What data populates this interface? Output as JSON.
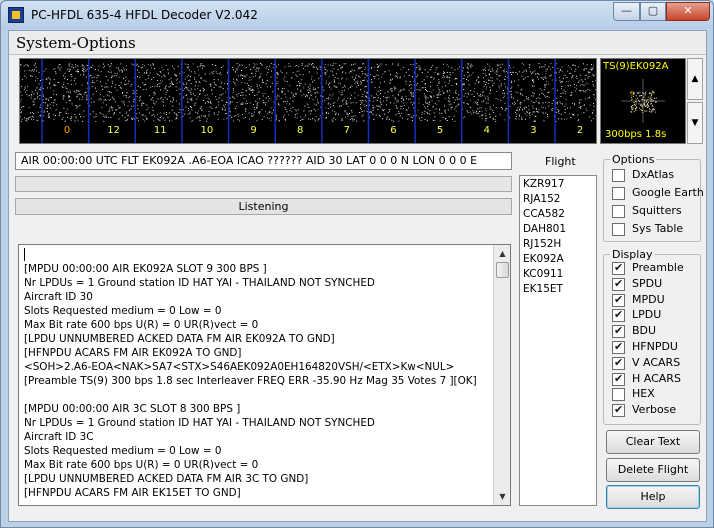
{
  "window": {
    "title": "PC-HFDL 635-4 HFDL Decoder V2.042",
    "controls": {
      "minimize": "—",
      "maximize": "▢",
      "close": "✕"
    }
  },
  "panel": {
    "title": "System-Options"
  },
  "spectrum": {
    "channel_labels": [
      "0",
      "12",
      "11",
      "10",
      "9",
      "8",
      "7",
      "6",
      "5",
      "4",
      "3",
      "2"
    ],
    "marker_color": "#1030c0",
    "label_color": "#ffa500"
  },
  "thumbnail": {
    "top_text": "TS(9)EK092A",
    "bottom_text": "300bps 1.8s"
  },
  "scroll_buttons": {
    "up": "▲",
    "down": "▼"
  },
  "message_line": "AIR 00:00:00  UTC FLT EK092A .A6-EOA ICAO ?????? AID 30 LAT 0 0 0  N  LON 0 0 0  E",
  "status": "Listening",
  "log_lines": [
    "[MPDU 00:00:00 AIR EK092A SLOT 9 300 BPS ]",
    "Nr LPDUs = 1 Ground station ID HAT YAI - THAILAND NOT SYNCHED",
    "Aircraft ID 30",
    "Slots Requested medium = 0 Low = 0",
    "Max Bit rate 600 bps U(R) = 0 UR(R)vect = 0",
    "[LPDU UNNUMBERED ACKED DATA FM AIR EK092A TO GND]",
    "[HFNPDU ACARS FM AIR EK092A TO GND]",
    "<SOH>2.A6-EOA<NAK>SA7<STX>S46AEK092A0EH164820VSH/<ETX>Kw<NUL>",
    "[Preamble TS(9) 300  bps 1.8 sec Interleaver FREQ ERR -35.90 Hz Mag 35 Votes 7 ][OK]",
    "",
    "[MPDU 00:00:00 AIR 3C SLOT 8 300 BPS ]",
    "Nr LPDUs = 1 Ground station ID HAT YAI - THAILAND NOT SYNCHED",
    "Aircraft ID 3C",
    "Slots Requested medium = 0 Low = 0",
    "Max Bit rate 600 bps U(R) = 0 UR(R)vect = 0",
    "[LPDU UNNUMBERED ACKED DATA FM AIR 3C TO GND]",
    "[HFNPDU ACARS FM AIR EK15ET TO GND]"
  ],
  "log_scroll": {
    "up": "▲",
    "down": "▼"
  },
  "flight": {
    "label": "Flight",
    "items": [
      "KZR917",
      "RJA152",
      "CCA582",
      "DAH801",
      "RJ152H",
      "EK092A",
      "KC0911",
      "EK15ET"
    ]
  },
  "options": {
    "title": "Options",
    "items": [
      {
        "label": "DxAtlas",
        "checked": false
      },
      {
        "label": "Google Earth",
        "checked": false
      },
      {
        "label": "Squitters",
        "checked": false
      },
      {
        "label": "Sys Table",
        "checked": false
      }
    ]
  },
  "display": {
    "title": "Display",
    "items": [
      {
        "label": "Preamble",
        "checked": true
      },
      {
        "label": "SPDU",
        "checked": true
      },
      {
        "label": "MPDU",
        "checked": true
      },
      {
        "label": "LPDU",
        "checked": true
      },
      {
        "label": "BDU",
        "checked": true
      },
      {
        "label": "HFNPDU",
        "checked": true
      },
      {
        "label": "V ACARS",
        "checked": true
      },
      {
        "label": "H ACARS",
        "checked": true
      },
      {
        "label": "HEX",
        "checked": false
      },
      {
        "label": "Verbose",
        "checked": true
      }
    ]
  },
  "buttons": {
    "clear_text": "Clear Text",
    "delete_flight": "Delete Flight",
    "help": "Help"
  }
}
